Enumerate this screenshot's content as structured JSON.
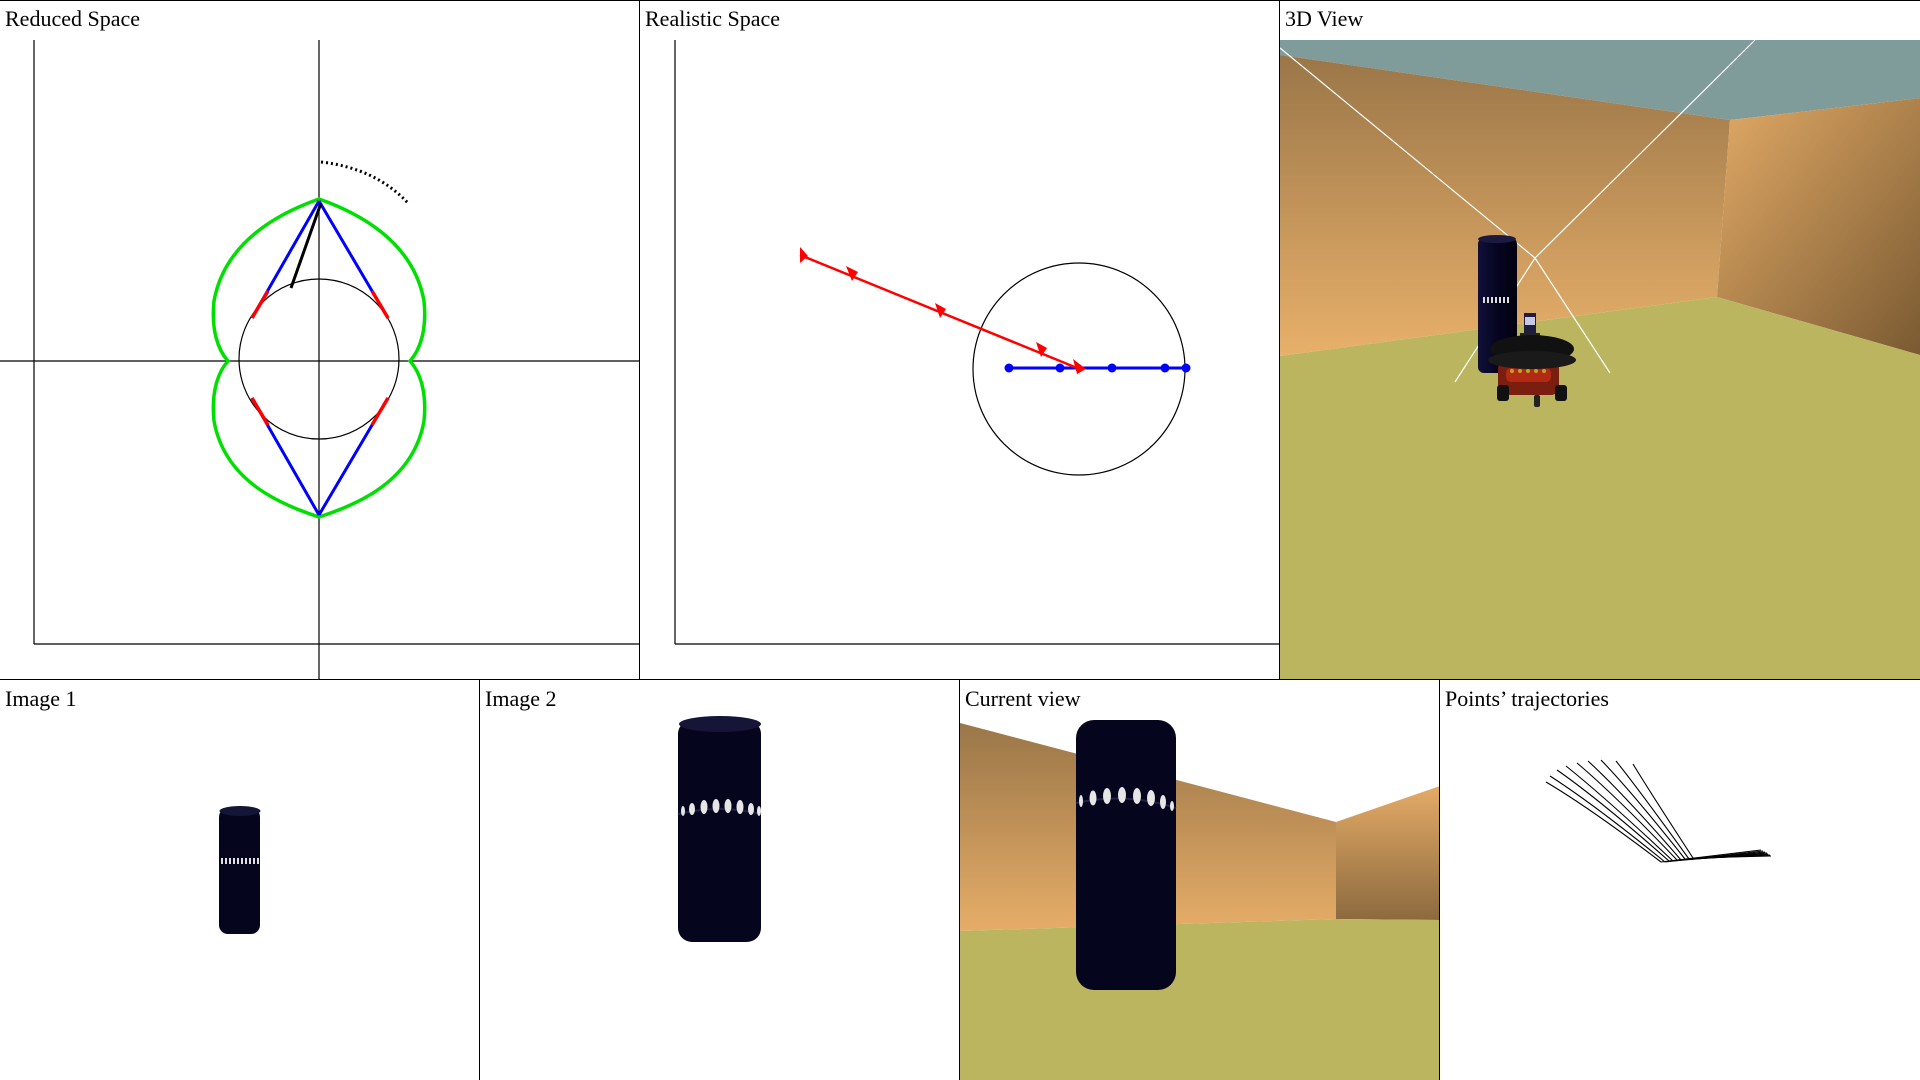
{
  "panels": {
    "reduced_space": {
      "title": "Reduced Space"
    },
    "realistic_space": {
      "title": "Realistic Space"
    },
    "view_3d": {
      "title": "3D View"
    },
    "image_1": {
      "title": "Image 1"
    },
    "image_2": {
      "title": "Image 2"
    },
    "current_view": {
      "title": "Current view"
    },
    "points_trajectories": {
      "title": "Points’ trajectories"
    }
  },
  "colors": {
    "green_curve": "#00e000",
    "blue_lines": "#0000ff",
    "red_segments": "#ff0000",
    "cylinder": "#05051e",
    "wall_light": "#e6b06c",
    "wall_dark": "#8c6a3e",
    "floor": "#bcb560",
    "ceiling": "#7f9b9a"
  }
}
